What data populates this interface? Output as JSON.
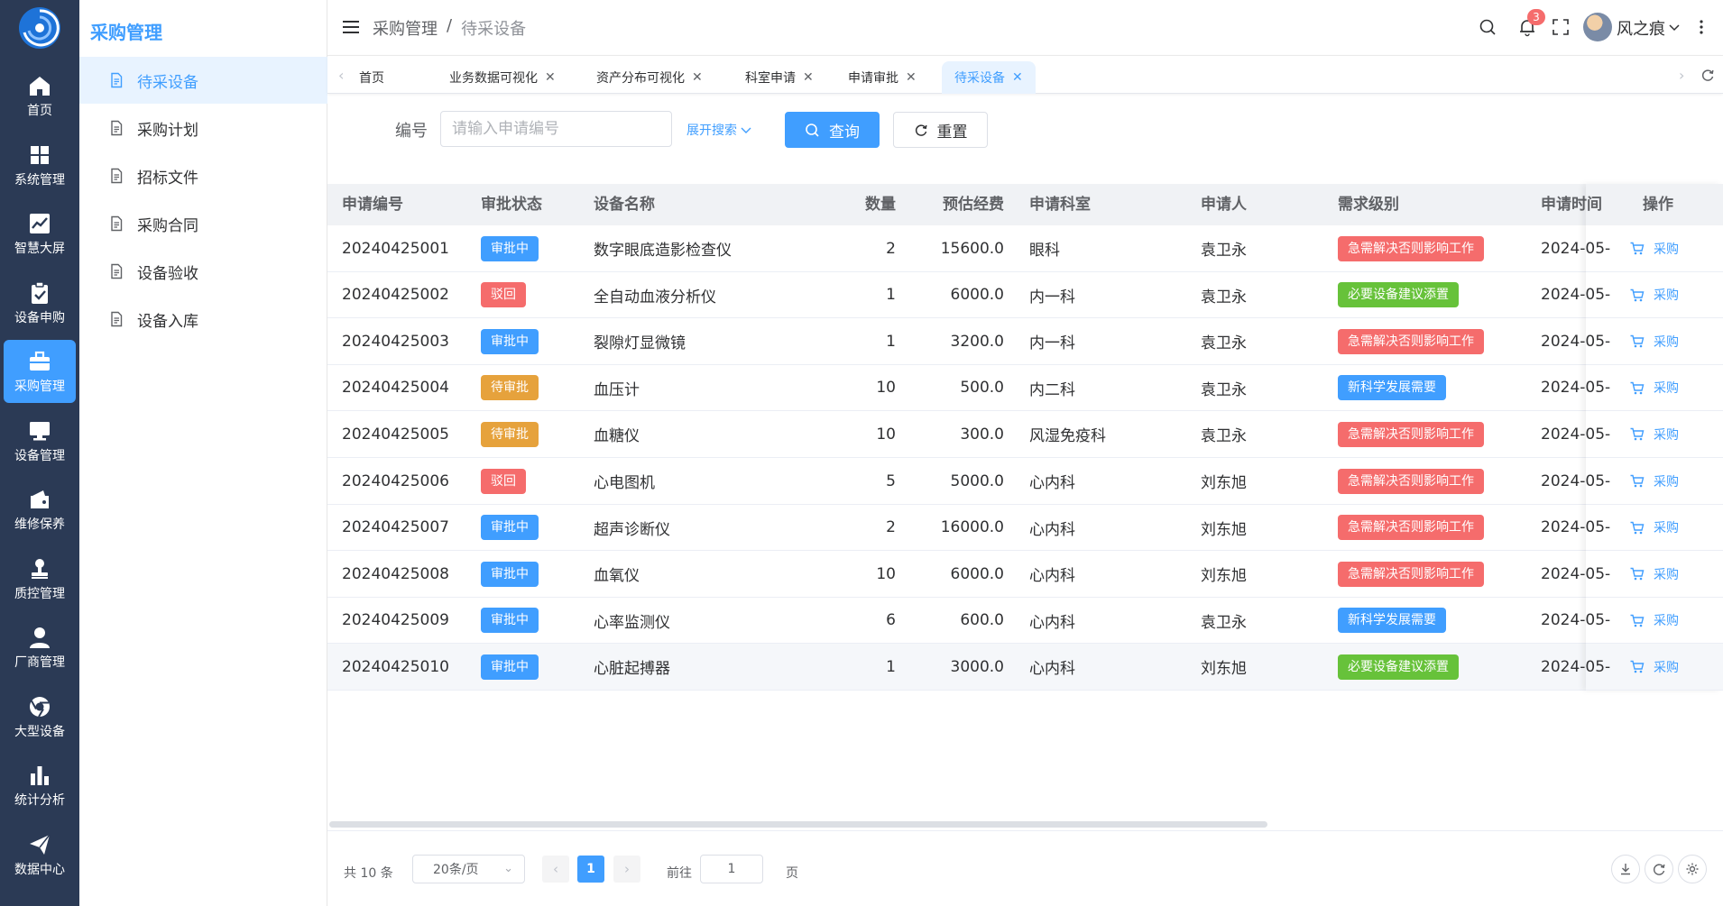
{
  "rail": {
    "items": [
      {
        "label": "首页",
        "icon": "home-icon"
      },
      {
        "label": "系统管理",
        "icon": "grid-icon"
      },
      {
        "label": "智慧大屏",
        "icon": "chart-line-icon"
      },
      {
        "label": "设备申购",
        "icon": "clipboard-check-icon"
      },
      {
        "label": "采购管理",
        "icon": "briefcase-icon",
        "active": true
      },
      {
        "label": "设备管理",
        "icon": "monitor-icon"
      },
      {
        "label": "维修保养",
        "icon": "wallet-icon"
      },
      {
        "label": "质控管理",
        "icon": "stamp-icon"
      },
      {
        "label": "厂商管理",
        "icon": "user-icon"
      },
      {
        "label": "大型设备",
        "icon": "chrome-icon"
      },
      {
        "label": "统计分析",
        "icon": "bar-chart-icon"
      },
      {
        "label": "数据中心",
        "icon": "paper-plane-icon"
      }
    ]
  },
  "submenu": {
    "title": "采购管理",
    "items": [
      "待采设备",
      "采购计划",
      "招标文件",
      "采购合同",
      "设备验收",
      "设备入库"
    ]
  },
  "header": {
    "breadcrumb": [
      "采购管理",
      "待采设备"
    ],
    "separator": "/",
    "notification_count": "3",
    "username": "风之痕"
  },
  "tabs": [
    {
      "label": "首页",
      "closable": false
    },
    {
      "label": "业务数据可视化",
      "closable": true
    },
    {
      "label": "资产分布可视化",
      "closable": true
    },
    {
      "label": "科室申请",
      "closable": true
    },
    {
      "label": "申请审批",
      "closable": true
    },
    {
      "label": "待采设备",
      "closable": true,
      "active": true
    }
  ],
  "search": {
    "label": "编号",
    "placeholder": "请输入申请编号",
    "value": "",
    "expand_label": "展开搜索",
    "query_label": "查询",
    "reset_label": "重置"
  },
  "table": {
    "columns": [
      "申请编号",
      "审批状态",
      "设备名称",
      "数量",
      "预估经费",
      "申请科室",
      "申请人",
      "需求级别",
      "申请时间",
      "操作"
    ],
    "action_label": "采购",
    "rows": [
      {
        "id": "20240425001",
        "status": "审批中",
        "name": "数字眼底造影检查仪",
        "qty": "2",
        "budget": "15600.0",
        "dept": "眼科",
        "applicant": "袁卫永",
        "level": "急需解决否则影响工作",
        "time": "2024-05-"
      },
      {
        "id": "20240425002",
        "status": "驳回",
        "name": "全自动血液分析仪",
        "qty": "1",
        "budget": "6000.0",
        "dept": "内一科",
        "applicant": "袁卫永",
        "level": "必要设备建议添置",
        "time": "2024-05-"
      },
      {
        "id": "20240425003",
        "status": "审批中",
        "name": "裂隙灯显微镜",
        "qty": "1",
        "budget": "3200.0",
        "dept": "内一科",
        "applicant": "袁卫永",
        "level": "急需解决否则影响工作",
        "time": "2024-05-"
      },
      {
        "id": "20240425004",
        "status": "待审批",
        "name": "血压计",
        "qty": "10",
        "budget": "500.0",
        "dept": "内二科",
        "applicant": "袁卫永",
        "level": "新科学发展需要",
        "time": "2024-05-"
      },
      {
        "id": "20240425005",
        "status": "待审批",
        "name": "血糖仪",
        "qty": "10",
        "budget": "300.0",
        "dept": "风湿免疫科",
        "applicant": "袁卫永",
        "level": "急需解决否则影响工作",
        "time": "2024-05-"
      },
      {
        "id": "20240425006",
        "status": "驳回",
        "name": "心电图机",
        "qty": "5",
        "budget": "5000.0",
        "dept": "心内科",
        "applicant": "刘东旭",
        "level": "急需解决否则影响工作",
        "time": "2024-05-"
      },
      {
        "id": "20240425007",
        "status": "审批中",
        "name": "超声诊断仪",
        "qty": "2",
        "budget": "16000.0",
        "dept": "心内科",
        "applicant": "刘东旭",
        "level": "急需解决否则影响工作",
        "time": "2024-05-"
      },
      {
        "id": "20240425008",
        "status": "审批中",
        "name": "血氧仪",
        "qty": "10",
        "budget": "6000.0",
        "dept": "心内科",
        "applicant": "刘东旭",
        "level": "急需解决否则影响工作",
        "time": "2024-05-"
      },
      {
        "id": "20240425009",
        "status": "审批中",
        "name": "心率监测仪",
        "qty": "6",
        "budget": "600.0",
        "dept": "心内科",
        "applicant": "袁卫永",
        "level": "新科学发展需要",
        "time": "2024-05-"
      },
      {
        "id": "20240425010",
        "status": "审批中",
        "name": "心脏起搏器",
        "qty": "1",
        "budget": "3000.0",
        "dept": "心内科",
        "applicant": "刘东旭",
        "level": "必要设备建议添置",
        "time": "2024-05-"
      }
    ]
  },
  "status_colors": {
    "审批中": "#409eff",
    "驳回": "#f56c6c",
    "待审批": "#e6a23c"
  },
  "level_colors": {
    "急需解决否则影响工作": "#f56c6c",
    "必要设备建议添置": "#67c23a",
    "新科学发展需要": "#409eff"
  },
  "pagination": {
    "total_text": "共 10 条",
    "page_size": "20条/页",
    "current_page": "1",
    "goto_label": "前往",
    "goto_value": "1",
    "page_suffix": "页"
  },
  "colors": {
    "accent": "#409eff",
    "rail_bg": "#2b3a55"
  }
}
